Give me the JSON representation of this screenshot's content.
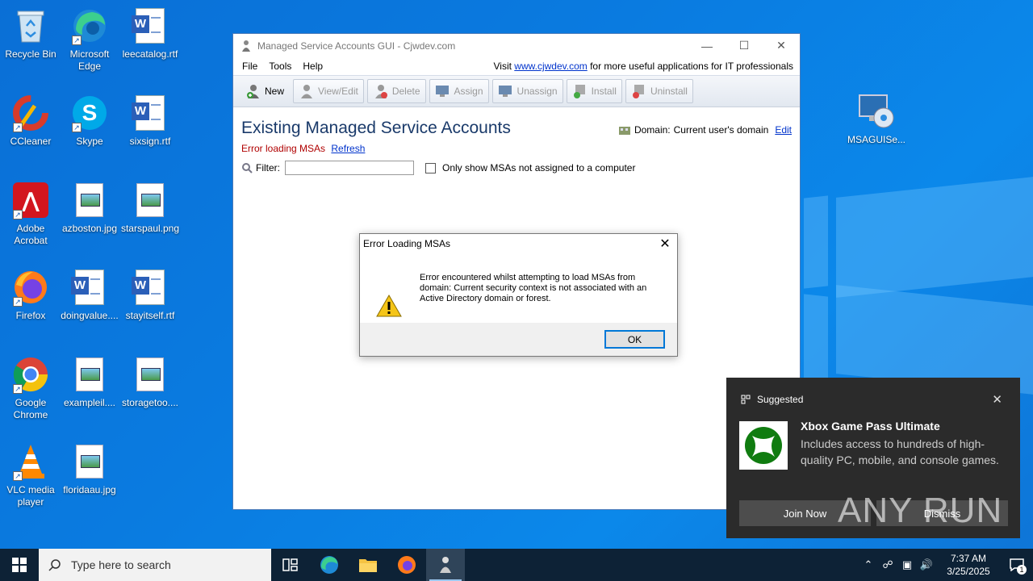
{
  "desktop": {
    "icons": [
      {
        "label": "Recycle Bin"
      },
      {
        "label": "Microsoft Edge"
      },
      {
        "label": "leecatalog.rtf"
      },
      {
        "label": "CCleaner"
      },
      {
        "label": "Skype"
      },
      {
        "label": "sixsign.rtf"
      },
      {
        "label": "Adobe Acrobat"
      },
      {
        "label": "azboston.jpg"
      },
      {
        "label": "starspaul.png"
      },
      {
        "label": "Firefox"
      },
      {
        "label": "doingvalue...."
      },
      {
        "label": "stayitself.rtf"
      },
      {
        "label": "Google Chrome"
      },
      {
        "label": "exampleil...."
      },
      {
        "label": "storagetoo...."
      },
      {
        "label": "VLC media player"
      },
      {
        "label": "floridaau.jpg"
      },
      {
        "label": "MSAGUISe..."
      }
    ]
  },
  "window": {
    "title": "Managed Service Accounts GUI - Cjwdev.com",
    "menu": [
      "File",
      "Tools",
      "Help"
    ],
    "visit_prefix": "Visit",
    "visit_link": "www.cjwdev.com",
    "visit_suffix": "for more useful applications for IT professionals",
    "toolbar": [
      "New",
      "View/Edit",
      "Delete",
      "Assign",
      "Unassign",
      "Install",
      "Uninstall"
    ],
    "heading": "Existing Managed Service Accounts",
    "domain_label": "Domain:",
    "domain_value": "Current user's domain",
    "domain_edit": "Edit",
    "error_text": "Error loading MSAs",
    "refresh": "Refresh",
    "filter_label": "Filter:",
    "filter_value": "",
    "checkbox_label": "Only show MSAs not assigned to a computer"
  },
  "dialog": {
    "title": "Error Loading MSAs",
    "message": "Error encountered whilst attempting to load MSAs from domain: Current security context is not associated with an Active Directory domain or forest.",
    "ok": "OK"
  },
  "toast": {
    "header": "Suggested",
    "title": "Xbox Game Pass Ultimate",
    "description": "Includes access to hundreds of high-quality PC, mobile, and console games.",
    "join": "Join Now",
    "dismiss": "Dismiss"
  },
  "watermark": "ANY RUN",
  "taskbar": {
    "search_placeholder": "Type here to search",
    "time": "7:37 AM",
    "date": "3/25/2025",
    "notification_count": "1"
  },
  "colors": {
    "desktop": "#0a7be0",
    "error": "#b00000",
    "link": "#0033cc",
    "heading": "#1a3a6a",
    "toast_bg": "#2b2b2b",
    "taskbar": "#0d2236"
  }
}
